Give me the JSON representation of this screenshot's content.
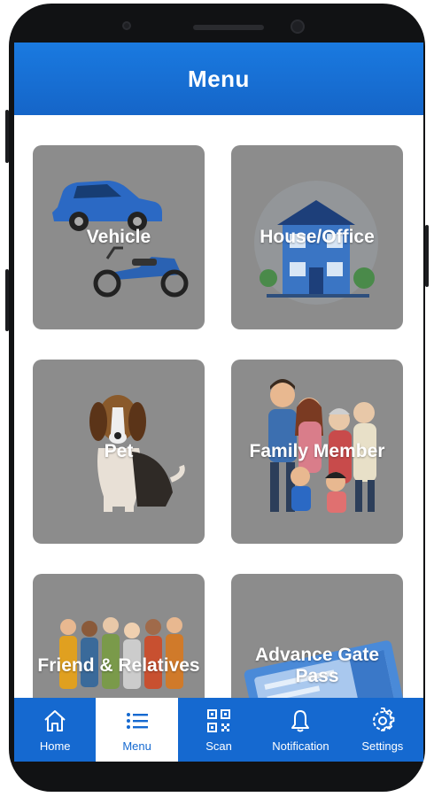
{
  "header": {
    "title": "Menu"
  },
  "cards": [
    {
      "label": "Vehicle"
    },
    {
      "label": "House/Office"
    },
    {
      "label": "Pet"
    },
    {
      "label": "Family Member"
    },
    {
      "label": "Friend & Relatives"
    },
    {
      "label": "Advance Gate Pass"
    }
  ],
  "bottom_nav": {
    "active": "Menu",
    "items": [
      {
        "label": "Home",
        "icon": "home-icon"
      },
      {
        "label": "Menu",
        "icon": "list-icon"
      },
      {
        "label": "Scan",
        "icon": "qr-code-icon"
      },
      {
        "label": "Notification",
        "icon": "bell-icon"
      },
      {
        "label": "Settings",
        "icon": "gear-icon"
      }
    ]
  },
  "colors": {
    "header_blue": "#1a7ae0",
    "nav_blue": "#1569d0",
    "card_grey": "#8c8c8c"
  }
}
